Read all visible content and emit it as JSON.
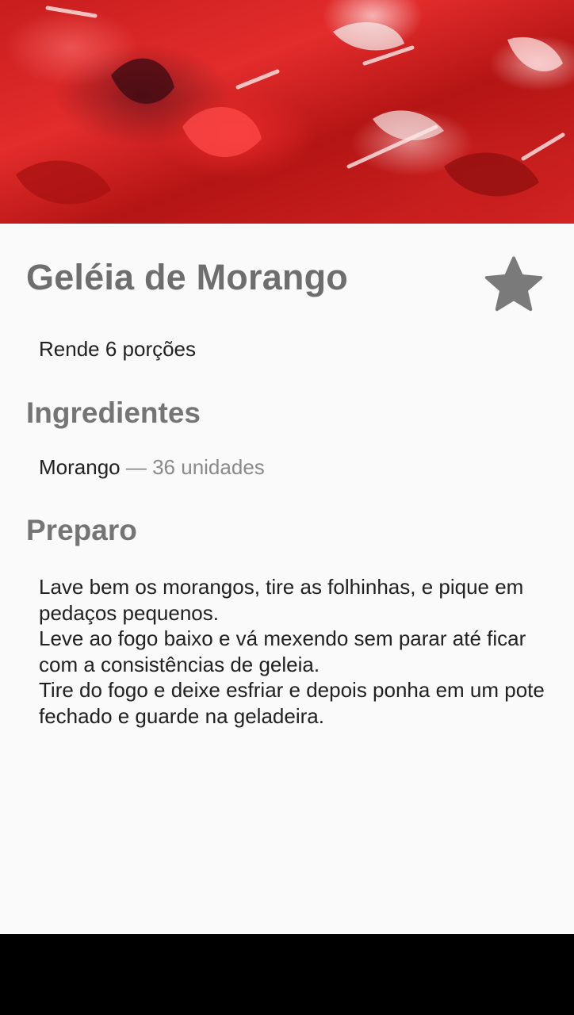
{
  "recipe": {
    "title": "Geléia de Morango",
    "favorite_icon": "star-icon",
    "yield": "Rende 6 porções"
  },
  "ingredients": {
    "heading": "Ingredientes",
    "items": [
      {
        "name": "Morango",
        "separator": "—",
        "quantity": "36 unidades"
      }
    ]
  },
  "preparation": {
    "heading": "Preparo",
    "steps": [
      "Lave bem os morangos, tire as folhinhas, e pique em pedaços pequenos.",
      "Leve ao fogo baixo e vá mexendo sem parar até ficar com a consistências de geleia.",
      "Tire do fogo e deixe esfriar e depois ponha em um pote fechado e guarde na geladeira."
    ]
  },
  "colors": {
    "title": "#6e6e6e",
    "body_text": "#212121",
    "secondary_text": "#8a8a8a",
    "star": "#7a7a7a",
    "background": "#fafafa",
    "navbar": "#000000"
  }
}
